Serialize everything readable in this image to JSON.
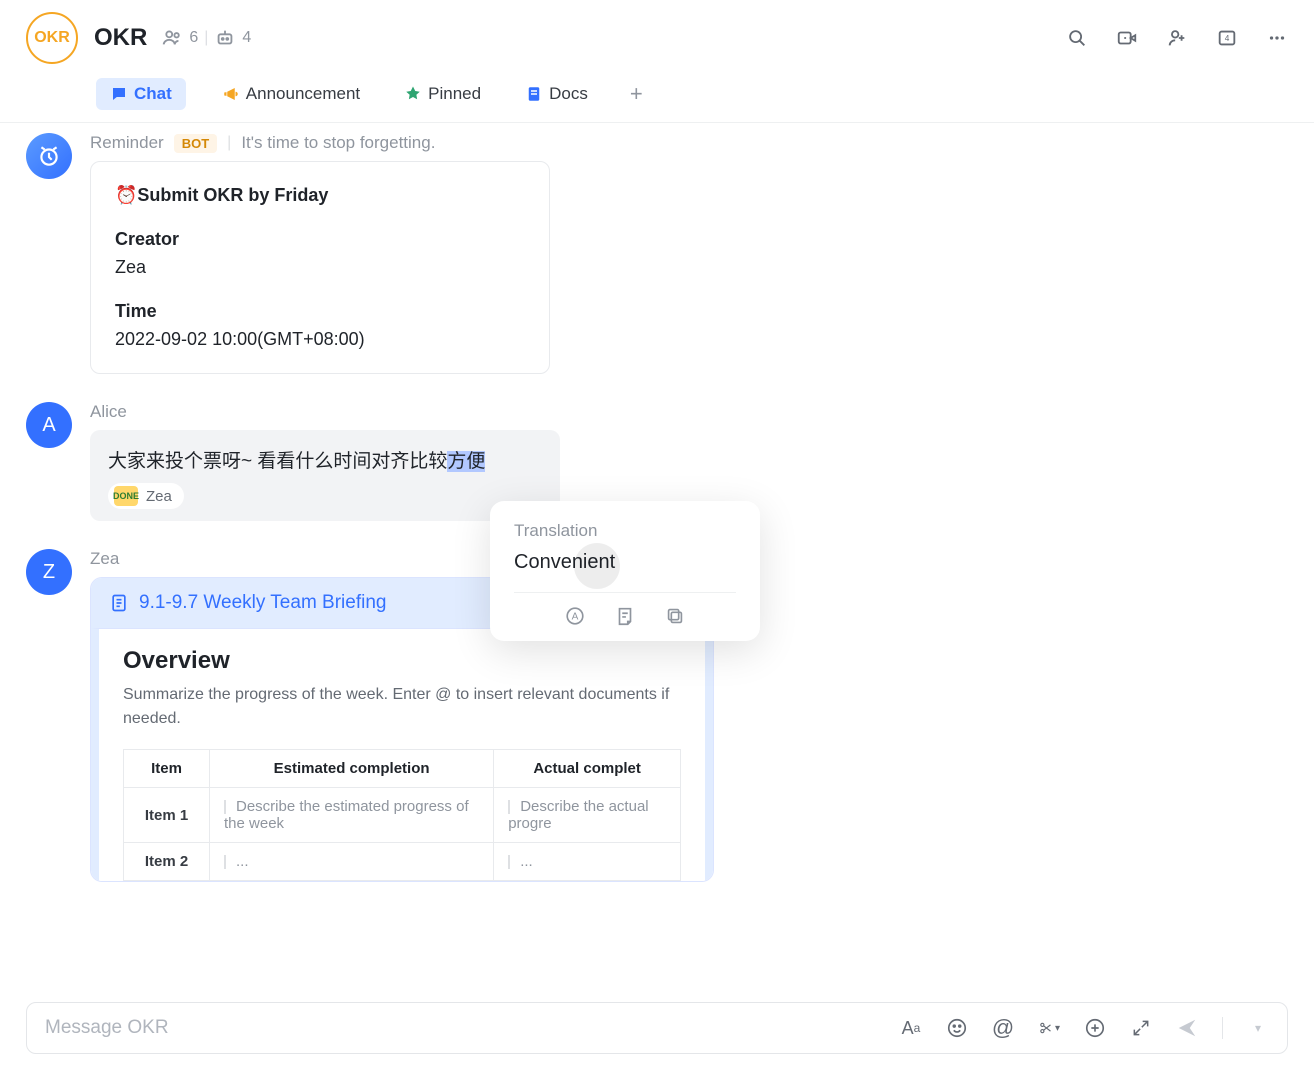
{
  "header": {
    "avatar_text": "OKR",
    "group_name": "OKR",
    "members": "6",
    "bots": "4"
  },
  "tabs": {
    "chat": "Chat",
    "announcement": "Announcement",
    "pinned": "Pinned",
    "docs": "Docs"
  },
  "reminder": {
    "sender": "Reminder",
    "bot_label": "BOT",
    "subtitle": "It's time to stop forgetting.",
    "card": {
      "title": "⏰Submit OKR by Friday",
      "creator_label": "Creator",
      "creator": "Zea",
      "time_label": "Time",
      "time": "2022-09-02 10:00(GMT+08:00)"
    }
  },
  "alice": {
    "sender": "Alice",
    "avatar_letter": "A",
    "text_plain": "大家来投个票呀~ 看看什么时间对齐比较",
    "text_hl": "方便",
    "reaction": {
      "emoji_text": "DONE",
      "name": "Zea"
    }
  },
  "translation": {
    "title": "Translation",
    "text": "Convenient"
  },
  "zea": {
    "sender": "Zea",
    "avatar_letter": "Z",
    "doc": {
      "title": "9.1-9.7 Weekly Team Briefing",
      "section": "Overview",
      "desc": "Summarize the progress of the week. Enter @ to insert relevant documents if needed.",
      "columns": [
        "Item",
        "Estimated completion",
        "Actual complet"
      ],
      "rows": [
        {
          "item": "Item 1",
          "est": "Describe the estimated progress of the week",
          "act": "Describe the actual progre"
        },
        {
          "item": "Item 2",
          "est": "...",
          "act": "..."
        }
      ]
    }
  },
  "composer": {
    "placeholder": "Message OKR"
  }
}
